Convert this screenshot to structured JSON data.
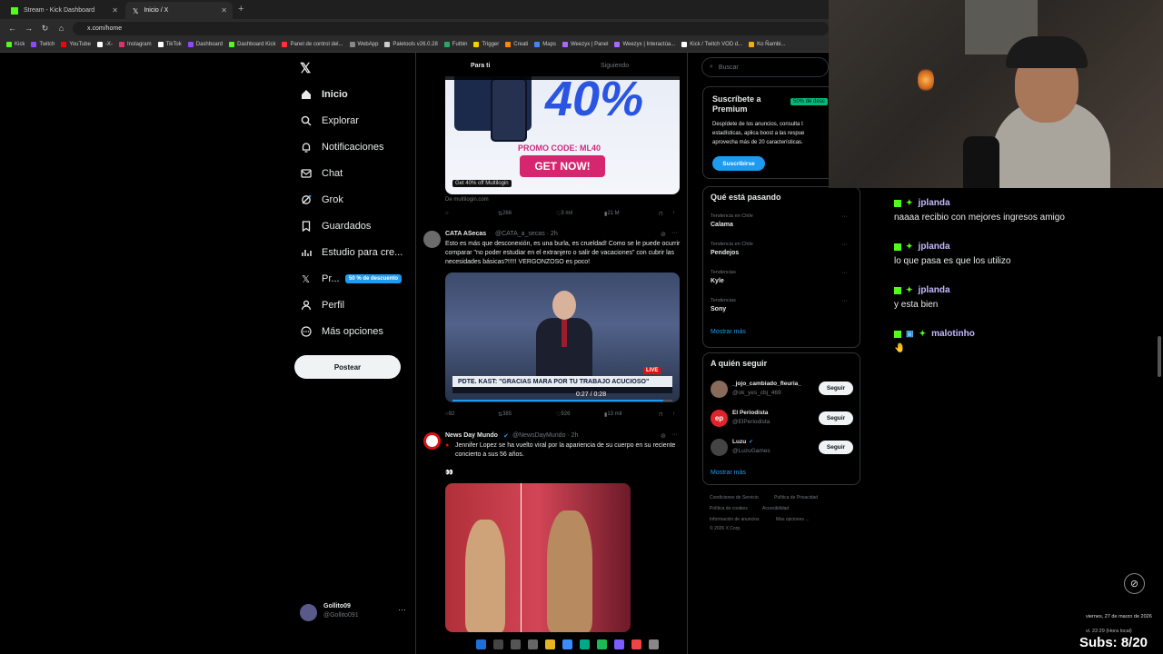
{
  "browser": {
    "tabs": [
      {
        "label": "Stream - Kick Dashboard",
        "active": false
      },
      {
        "label": "Inicio / X",
        "active": true
      }
    ],
    "url": "x.com/home",
    "bookmarks": [
      "Kick",
      "Twitch",
      "YouTube",
      "-X-",
      "Instagram",
      "TikTok",
      "Dashboard",
      "Dashboard Kick",
      "Panel de control del...",
      "WebApp",
      "Paletools v26.0.28",
      "Futbin",
      "Trigger",
      "Creati",
      "Maps",
      "Weezyx | Panel",
      "Weezyx | Interactúa...",
      "Kick / Twitch VOD d...",
      "Ko Ñambi..."
    ]
  },
  "sidebar": {
    "items": [
      {
        "label": "Inicio",
        "icon": "home-icon"
      },
      {
        "label": "Explorar",
        "icon": "search-icon"
      },
      {
        "label": "Notificaciones",
        "icon": "bell-icon"
      },
      {
        "label": "Chat",
        "icon": "mail-icon"
      },
      {
        "label": "Grok",
        "icon": "grok-icon"
      },
      {
        "label": "Guardados",
        "icon": "bookmark-icon"
      },
      {
        "label": "Estudio para cre...",
        "icon": "studio-icon"
      },
      {
        "label": "Pr...",
        "icon": "x-premium-icon"
      },
      {
        "label": "Perfil",
        "icon": "person-icon"
      },
      {
        "label": "Más opciones",
        "icon": "more-circle-icon"
      }
    ],
    "premium_badge": "50 % de descuento",
    "post_button": "Postear",
    "account": {
      "name": "Gollito09",
      "handle": "@Gollito091"
    }
  },
  "feed": {
    "tabs": [
      "Para ti",
      "Siguiendo"
    ],
    "ad": {
      "big_text": "40%",
      "promo": "PROMO CODE: ML40",
      "cta": "GET NOW!",
      "caption": "Get 40% off Multilogin",
      "source": "De multilogin.com",
      "stats": {
        "retweets": "266",
        "likes": "3 mil",
        "views": "21 M"
      }
    },
    "tweets": [
      {
        "name": "CATA ASecas",
        "handle": "@CATA_a_secas · 2h",
        "text": "Esto es más que desconexión, es una burla, es crueldad! Como se le puede ocurrir comparar \"no poder estudiar en el extranjero o salir de vacaciones\" con cubrir las necesidades básicas?!!!!! VERGONZOSO es poco!",
        "video": {
          "lower_third": "PDTE. KAST: \"GRACIAS MARA POR TU TRABAJO ACUCIOSO\"",
          "live": "LIVE",
          "time": "0:27 / 0:28",
          "progress": 0.96
        },
        "stats": {
          "replies": "92",
          "retweets": "385",
          "likes": "926",
          "views": "13 mil"
        }
      },
      {
        "name": "News Day Mundo",
        "handle": "@NewsDayMundo · 2h",
        "text": "Jennifer Lopez se ha vuelto viral por la apariencia de su cuerpo en su reciente concierto a sus 56 años.",
        "emoji": "👀"
      }
    ]
  },
  "right": {
    "search_placeholder": "Buscar",
    "premium": {
      "title": "Suscríbete a Premium",
      "badge": "50% de desc",
      "desc": "Despídete de los anuncios, consulta t estadísticas, aplica boost a las respue aprovecha más de 20 características.",
      "button": "Suscribirse"
    },
    "trends": {
      "title": "Qué está pasando",
      "items": [
        {
          "category": "Tendencia en Chile",
          "name": "Calama"
        },
        {
          "category": "Tendencia en Chile",
          "name": "Pendejos"
        },
        {
          "category": "Tendencias",
          "name": "Kyle"
        },
        {
          "category": "Tendencias",
          "name": "Sony"
        }
      ],
      "show_more": "Mostrar más"
    },
    "who_to_follow": {
      "title": "A quién seguir",
      "items": [
        {
          "name": "_jojo_cambiado_fleuria_",
          "handle": "@ok_yes_cbj_469",
          "button": "Seguir"
        },
        {
          "name": "El Periodista",
          "handle": "@ElPeriodista",
          "button": "Seguir"
        },
        {
          "name": "Luzu",
          "handle": "@LuzuGames",
          "button": "Seguir"
        }
      ],
      "show_more": "Mostrar más"
    },
    "footer": [
      "Condiciones de Servicio",
      "Política de Privacidad",
      "Política de cookies",
      "Accesibilidad",
      "Información de anuncios",
      "Más opciones ...",
      "© 2026 X Corp."
    ]
  },
  "chat": {
    "messages": [
      {
        "user": "jplanda",
        "text": "naaaa recibio con mejores ingresos amigo"
      },
      {
        "user": "jplanda",
        "text": "lo que pasa es que los utilizo"
      },
      {
        "user": "jplanda",
        "text": "y esta bien"
      },
      {
        "user": "malotinho",
        "text": "🤚"
      }
    ]
  },
  "overlay": {
    "date": "viernes, 27 de marzo de 2026",
    "time": "vi. 22:29 (Hora local)",
    "subs": "Subs: 8/20"
  },
  "colors": {
    "kick_green": "#53fc18",
    "x_blue": "#1d9bf0",
    "premium_green": "#00ba7c"
  }
}
